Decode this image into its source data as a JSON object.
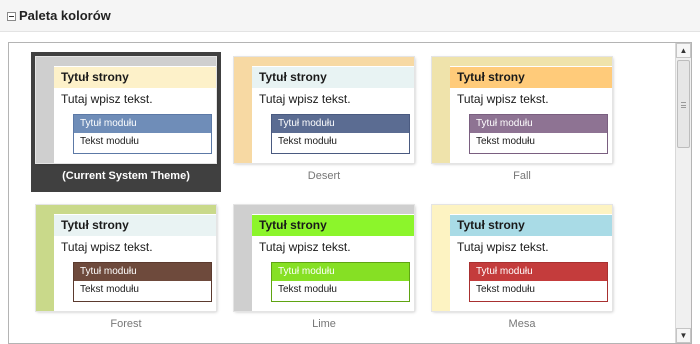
{
  "section": {
    "title": "Paleta kolorów"
  },
  "preview_text": {
    "page_title": "Tytuł strony",
    "page_text": "Tutaj wpisz tekst.",
    "module_title": "Tytuł modułu",
    "module_text": "Tekst modułu"
  },
  "themes": [
    {
      "name": "(Current System Theme)",
      "selected": true,
      "colors": {
        "top": "#cfcfcf",
        "left": "#cfcfcf",
        "title_bg": "#fdf1c9",
        "module_header": "#6f8db8",
        "module_border": "#5c79a6"
      }
    },
    {
      "name": "Desert",
      "selected": false,
      "colors": {
        "top": "#f7d9a3",
        "left": "#f7d9a3",
        "title_bg": "#e8f3f3",
        "module_header": "#5b6c92",
        "module_border": "#4a5a80"
      }
    },
    {
      "name": "Fall",
      "selected": false,
      "colors": {
        "top": "#efe3ab",
        "left": "#efe3ab",
        "title_bg": "#ffcb7a",
        "module_header": "#8e7393",
        "module_border": "#7a5f80"
      }
    },
    {
      "name": "Forest",
      "selected": false,
      "colors": {
        "top": "#c9d98a",
        "left": "#c9d98a",
        "title_bg": "#e9f3f3",
        "module_header": "#6e4a3c",
        "module_border": "#5b3a2e"
      }
    },
    {
      "name": "Lime",
      "selected": false,
      "colors": {
        "top": "#cfcfcf",
        "left": "#cfcfcf",
        "title_bg": "#8cf52b",
        "module_header": "#86e024",
        "module_border": "#5fa412"
      }
    },
    {
      "name": "Mesa",
      "selected": false,
      "colors": {
        "top": "#fdf3c2",
        "left": "#fdf3c2",
        "title_bg": "#a9dbe6",
        "module_header": "#c43c3c",
        "module_border": "#a83030"
      }
    }
  ],
  "scrollbar": {
    "up_icon": "arrow-up-icon",
    "down_icon": "arrow-down-icon"
  }
}
